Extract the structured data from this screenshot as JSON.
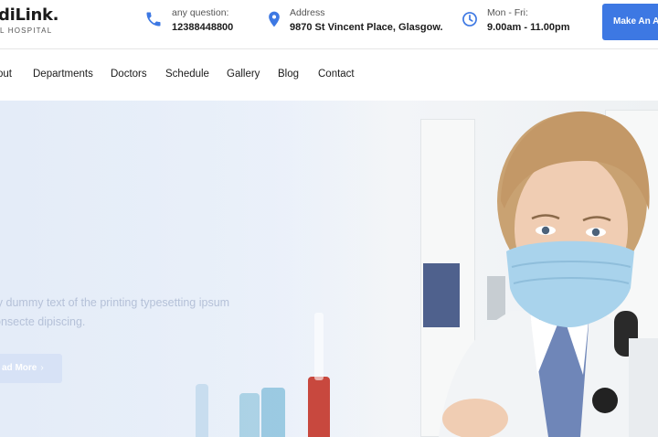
{
  "brand": {
    "name": "diLink.",
    "tagline": "L HOSPITAL"
  },
  "contact": {
    "phone": {
      "label": "any question:",
      "value": "12388448800",
      "icon": "phone-icon"
    },
    "address": {
      "label": "Address",
      "value": "9870 St Vincent Place, Glasgow.",
      "icon": "location-pin-icon"
    },
    "hours": {
      "label": "Mon - Fri:",
      "value": "9.00am - 11.00pm",
      "icon": "clock-icon"
    }
  },
  "cta": {
    "label": "Make An Ap"
  },
  "nav": {
    "items": [
      "out",
      "Departments",
      "Doctors",
      "Schedule",
      "Gallery",
      "Blog",
      "Contact"
    ]
  },
  "hero": {
    "line1": "ly dummy text of the printing typesetting ipsum",
    "line2": "onsecte dipiscing.",
    "button": "ad More",
    "button_icon": "chevron-right-icon"
  },
  "colors": {
    "accent": "#3d78e3",
    "text": "#1b1b1b",
    "hero_text": "#b5c1d8",
    "hero_bg": "#e4ecf8"
  }
}
